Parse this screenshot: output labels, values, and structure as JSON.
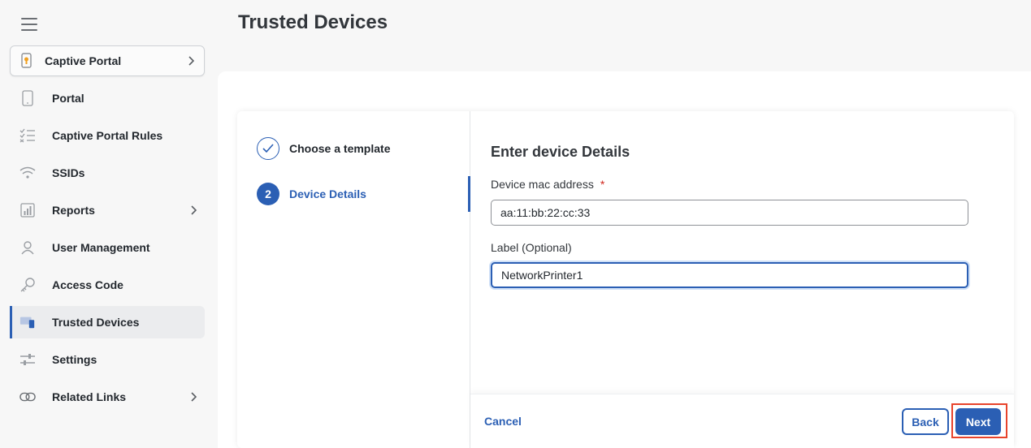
{
  "page": {
    "title": "Trusted Devices"
  },
  "sidebar": {
    "app_switcher": {
      "label": "Captive Portal",
      "icon": "captive-portal-icon"
    },
    "items": [
      {
        "label": "Portal",
        "icon": "phone-icon",
        "has_submenu": false
      },
      {
        "label": "Captive Portal Rules",
        "icon": "checklist-icon",
        "has_submenu": false
      },
      {
        "label": "SSIDs",
        "icon": "wifi-icon",
        "has_submenu": false
      },
      {
        "label": "Reports",
        "icon": "bar-chart-icon",
        "has_submenu": true
      },
      {
        "label": "User Management",
        "icon": "user-icon",
        "has_submenu": false
      },
      {
        "label": "Access Code",
        "icon": "key-icon",
        "has_submenu": false
      },
      {
        "label": "Trusted Devices",
        "icon": "devices-icon",
        "has_submenu": false,
        "active": true
      },
      {
        "label": "Settings",
        "icon": "sliders-icon",
        "has_submenu": false
      },
      {
        "label": "Related Links",
        "icon": "link-icon",
        "has_submenu": true
      }
    ]
  },
  "wizard": {
    "steps": [
      {
        "label": "Choose a template",
        "state": "done"
      },
      {
        "number": "2",
        "label": "Device Details",
        "state": "current"
      }
    ],
    "form": {
      "title": "Enter device Details",
      "mac_label": "Device mac address",
      "required_mark": "*",
      "mac_value": "aa:11:bb:22:cc:33",
      "label_label": "Label (Optional)",
      "label_value": "NetworkPrinter1"
    },
    "footer": {
      "cancel": "Cancel",
      "back": "Back",
      "next": "Next"
    }
  },
  "colors": {
    "accent": "#2b5fb4",
    "required": "#d0271d",
    "highlight": "#e8432b"
  }
}
